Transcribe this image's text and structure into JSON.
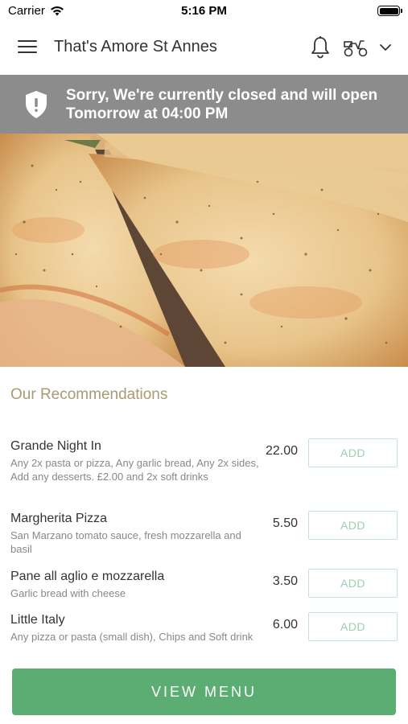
{
  "status_bar": {
    "carrier": "Carrier",
    "time": "5:16 PM"
  },
  "nav": {
    "title": "That's Amore St Annes",
    "icons": [
      "hamburger-menu-icon",
      "bell-icon",
      "scooter-icon",
      "chevron-down-icon"
    ]
  },
  "banner": {
    "message": "Sorry, We're currently closed and will open Tomorrow at 04:00 PM",
    "icon": "shield-alert-icon",
    "background": "#8c8c8c"
  },
  "recommendations": {
    "heading": "Our Recommendations",
    "items": [
      {
        "name": "Grande Night In",
        "description": "Any 2x pasta or pizza, Any garlic bread, Any 2x sides, Add any desserts. £2.00 and 2x soft drinks",
        "price": "22.00",
        "button": "ADD"
      },
      {
        "name": "Margherita Pizza",
        "description": "San Marzano tomato sauce, fresh mozzarella and basil",
        "price": "5.50",
        "button": "ADD"
      },
      {
        "name": "Pane all aglio e mozzarella",
        "description": "Garlic bread with cheese",
        "price": "3.50",
        "button": "ADD"
      },
      {
        "name": "Little Italy",
        "description": "Any pizza or pasta (small dish), Chips and Soft drink",
        "price": "6.00",
        "button": "ADD"
      }
    ]
  },
  "view_menu_label": "VIEW MENU",
  "colors": {
    "accent_green": "#5cad73",
    "heading_gold": "#a89a73"
  }
}
